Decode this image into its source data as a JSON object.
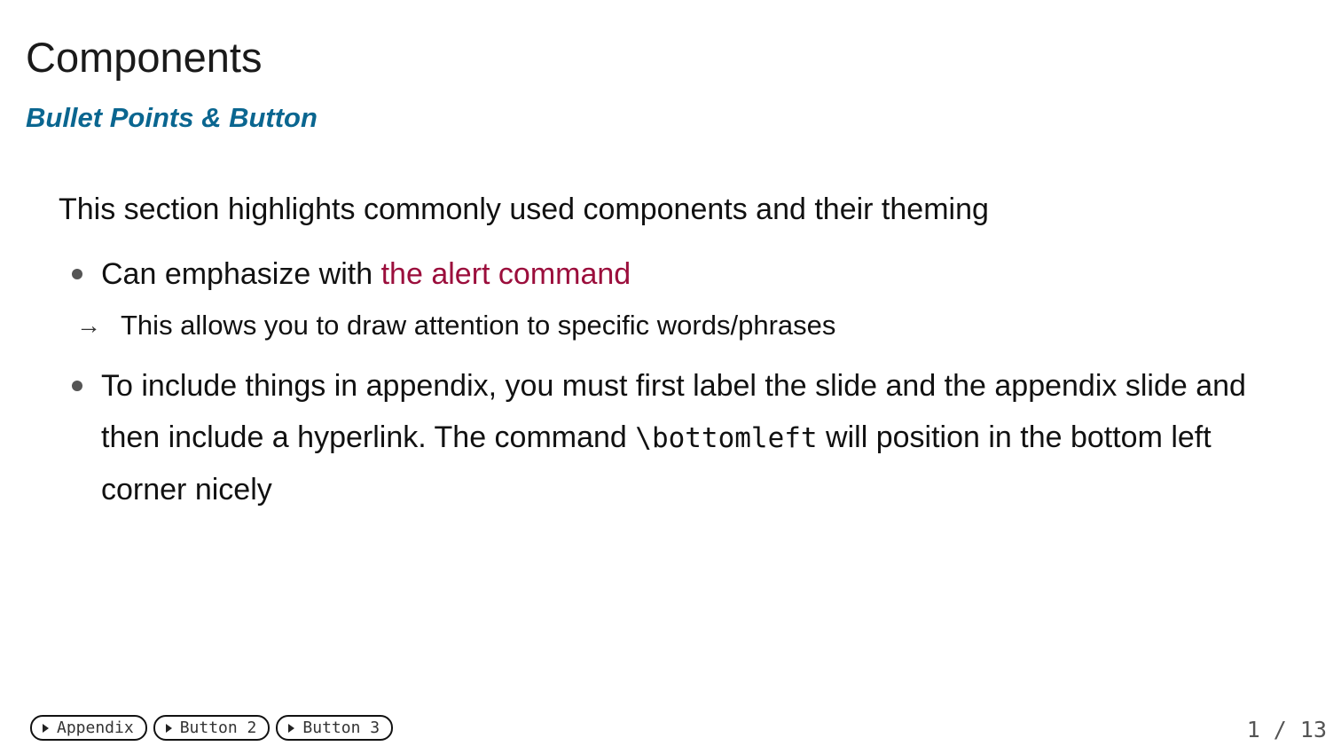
{
  "slide": {
    "title": "Components",
    "subtitle": "Bullet Points & Button",
    "intro": "This section highlights commonly used components and their theming",
    "bullets": [
      {
        "prefix": "Can emphasize with ",
        "alert": "the alert command",
        "sub": "This allows you to draw attention to specific words/phrases"
      },
      {
        "text_1": "To include things in appendix, you must first label the slide and the appendix slide and then include a hyperlink. The command ",
        "code": "\\bottomleft",
        "text_2": " will position in the bottom left corner nicely"
      }
    ],
    "sub_marker": "→"
  },
  "footer": {
    "buttons": [
      {
        "label": "Appendix"
      },
      {
        "label": "Button 2"
      },
      {
        "label": "Button 3"
      }
    ],
    "page_number": "1 / 13"
  },
  "colors": {
    "subtitle": "#0a6690",
    "alert": "#9b0e3c"
  },
  "icons": {
    "button_marker": "play-triangle-icon",
    "bullet_marker": "bullet-dot-icon",
    "sub_marker": "right-arrow-icon"
  }
}
